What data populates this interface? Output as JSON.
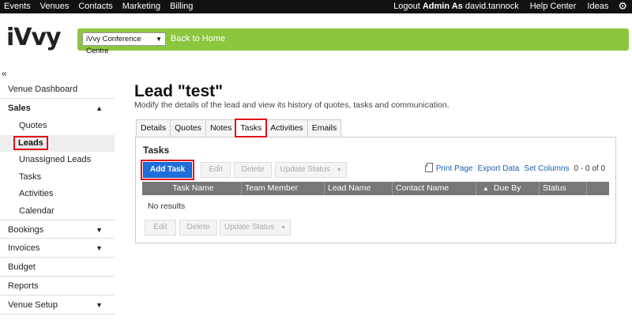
{
  "topnav": {
    "items": [
      "Events",
      "Venues",
      "Contacts",
      "Marketing",
      "Billing"
    ],
    "logout_prefix": "Logout",
    "admin_label": "Admin As",
    "user": "david.tannock",
    "help": "Help Center",
    "ideas": "Ideas",
    "settings_icon": "gear-icon"
  },
  "header": {
    "logo_text": "iVvy",
    "venue_select": "iVvy Conference Centre",
    "back_home": "Back to Home",
    "brand_color": "#8cc63f"
  },
  "sidebar": {
    "collapse": "«",
    "items": [
      {
        "label": "Venue Dashboard"
      },
      {
        "label": "Sales"
      },
      {
        "label": "Quotes"
      },
      {
        "label": "Leads"
      },
      {
        "label": "Unassigned Leads"
      },
      {
        "label": "Tasks"
      },
      {
        "label": "Activities"
      },
      {
        "label": "Calendar"
      },
      {
        "label": "Bookings"
      },
      {
        "label": "Invoices"
      },
      {
        "label": "Budget"
      },
      {
        "label": "Reports"
      },
      {
        "label": "Venue Setup"
      }
    ]
  },
  "main": {
    "title": "Lead \"test\"",
    "subtitle": "Modify the details of the lead and view its history of quotes, tasks and communication.",
    "tabs": [
      "Details",
      "Quotes",
      "Notes",
      "Tasks",
      "Activities",
      "Emails"
    ],
    "active_tab": "Tasks",
    "panel": {
      "title": "Tasks",
      "add_task": "Add Task",
      "edit": "Edit",
      "delete": "Delete",
      "update_status": "Update Status",
      "print_page": "Print Page",
      "export_data": "Export Data",
      "set_columns": "Set Columns",
      "count": "0 - 0 of 0",
      "columns": [
        "Task Name",
        "Team Member",
        "Lead Name",
        "Contact Name",
        "Due By",
        "Status"
      ],
      "sort_indicator": "▲",
      "no_results": "No results"
    }
  }
}
